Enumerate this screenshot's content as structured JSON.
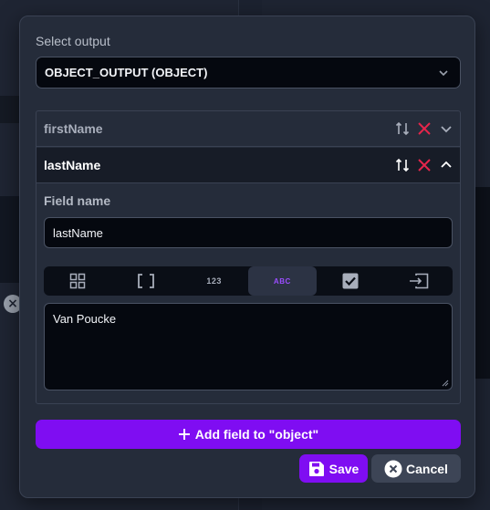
{
  "dialog": {
    "title": "Select output",
    "select_value": "OBJECT_OUTPUT (OBJECT)"
  },
  "fields": [
    {
      "name": "firstName",
      "expanded": false
    },
    {
      "name": "lastName",
      "expanded": true
    }
  ],
  "detail": {
    "field_name_label": "Field name",
    "field_name_value": "lastName",
    "type_options": [
      "object-icon",
      "array-icon",
      "number-icon",
      "string-icon",
      "boolean-icon",
      "reference-icon"
    ],
    "type_number_text": "123",
    "type_string_text": "ABC",
    "selected_type": "string",
    "value": "Van Poucke"
  },
  "buttons": {
    "add_field": "Add field to \"object\"",
    "save": "Save",
    "cancel": "Cancel"
  },
  "colors": {
    "accent": "#7f0df2",
    "delete": "#e5254b",
    "dialog_bg": "#252c3a"
  }
}
